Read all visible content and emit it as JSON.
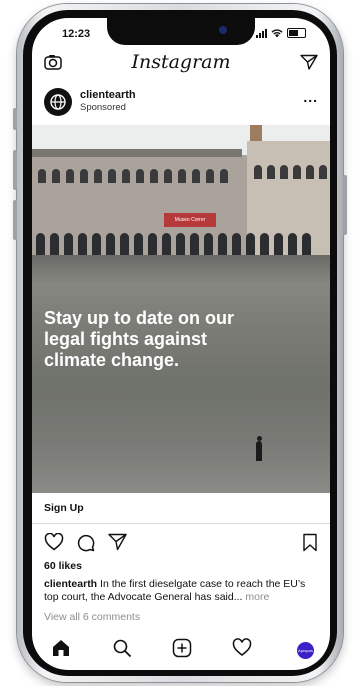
{
  "status_bar": {
    "time": "12:23"
  },
  "header": {
    "logo": "Instagram",
    "camera_icon": "camera-icon",
    "send_icon": "send-icon"
  },
  "post": {
    "username": "clientearth",
    "sponsored_label": "Sponsored",
    "more_label": "...",
    "image_text": "Stay up to date on our legal fights against climate change.",
    "sign_text": "Museo Correr",
    "cta_label": "Sign Up",
    "likes": "60 likes",
    "caption_user": "clientearth",
    "caption_text": "In the first dieselgate case to reach the EU’s top court, the Advocate General has said...",
    "caption_more": "more",
    "view_comments": "View all 6 comments"
  },
  "tabbar": {
    "profile_label": "Apropos"
  },
  "colors": {
    "profile_accent": "#3a22c8"
  }
}
